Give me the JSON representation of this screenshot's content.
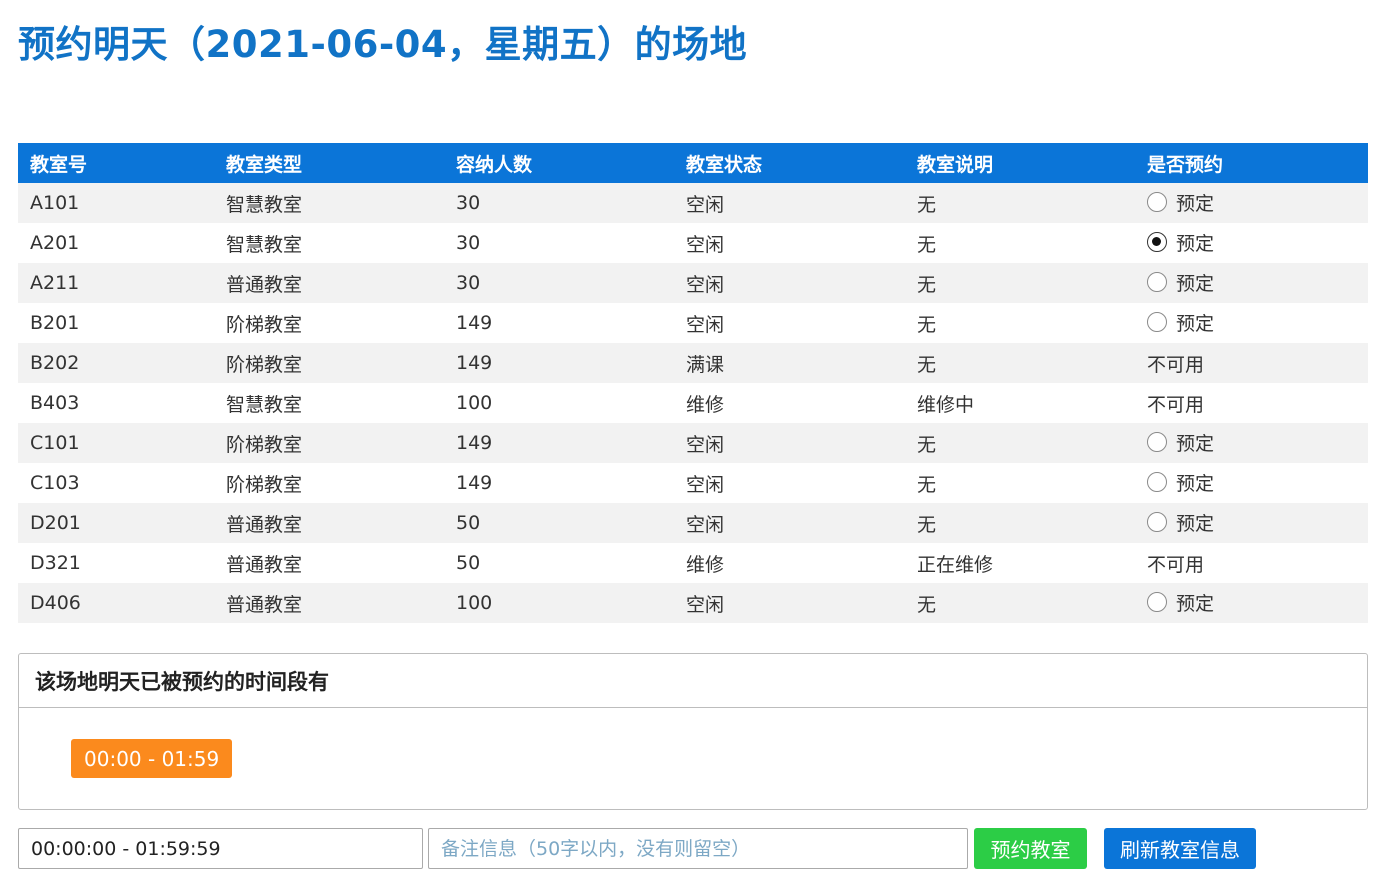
{
  "page": {
    "title": "预约明天（2021-06-04，星期五）的场地"
  },
  "table": {
    "headers": [
      "教室号",
      "教室类型",
      "容纳人数",
      "教室状态",
      "教室说明",
      "是否预约"
    ],
    "rows": [
      {
        "room": "A101",
        "type": "智慧教室",
        "capacity": "30",
        "status": "空闲",
        "note": "无",
        "book": "预定",
        "bookable": true,
        "checked": false
      },
      {
        "room": "A201",
        "type": "智慧教室",
        "capacity": "30",
        "status": "空闲",
        "note": "无",
        "book": "预定",
        "bookable": true,
        "checked": true
      },
      {
        "room": "A211",
        "type": "普通教室",
        "capacity": "30",
        "status": "空闲",
        "note": "无",
        "book": "预定",
        "bookable": true,
        "checked": false
      },
      {
        "room": "B201",
        "type": "阶梯教室",
        "capacity": "149",
        "status": "空闲",
        "note": "无",
        "book": "预定",
        "bookable": true,
        "checked": false
      },
      {
        "room": "B202",
        "type": "阶梯教室",
        "capacity": "149",
        "status": "满课",
        "note": "无",
        "book": "不可用",
        "bookable": false,
        "checked": false
      },
      {
        "room": "B403",
        "type": "智慧教室",
        "capacity": "100",
        "status": "维修",
        "note": "维修中",
        "book": "不可用",
        "bookable": false,
        "checked": false
      },
      {
        "room": "C101",
        "type": "阶梯教室",
        "capacity": "149",
        "status": "空闲",
        "note": "无",
        "book": "预定",
        "bookable": true,
        "checked": false
      },
      {
        "room": "C103",
        "type": "阶梯教室",
        "capacity": "149",
        "status": "空闲",
        "note": "无",
        "book": "预定",
        "bookable": true,
        "checked": false
      },
      {
        "room": "D201",
        "type": "普通教室",
        "capacity": "50",
        "status": "空闲",
        "note": "无",
        "book": "预定",
        "bookable": true,
        "checked": false
      },
      {
        "room": "D321",
        "type": "普通教室",
        "capacity": "50",
        "status": "维修",
        "note": "正在维修",
        "book": "不可用",
        "bookable": false,
        "checked": false
      },
      {
        "room": "D406",
        "type": "普通教室",
        "capacity": "100",
        "status": "空闲",
        "note": "无",
        "book": "预定",
        "bookable": true,
        "checked": false
      }
    ]
  },
  "booked_panel": {
    "title": "该场地明天已被预约的时间段有",
    "slots": [
      "00:00 - 01:59"
    ]
  },
  "form": {
    "time_value": "00:00:00 - 01:59:59",
    "note_placeholder": "备注信息（50字以内，没有则留空）",
    "book_label": "预约教室",
    "refresh_label": "刷新教室信息"
  },
  "colors": {
    "title": "#1173c6",
    "header_bg": "#0b75d8",
    "stripe": "#f2f2f2",
    "slot_badge": "#fb8a1d",
    "book_button": "#2ccd46",
    "refresh_button": "#0b75d8"
  }
}
